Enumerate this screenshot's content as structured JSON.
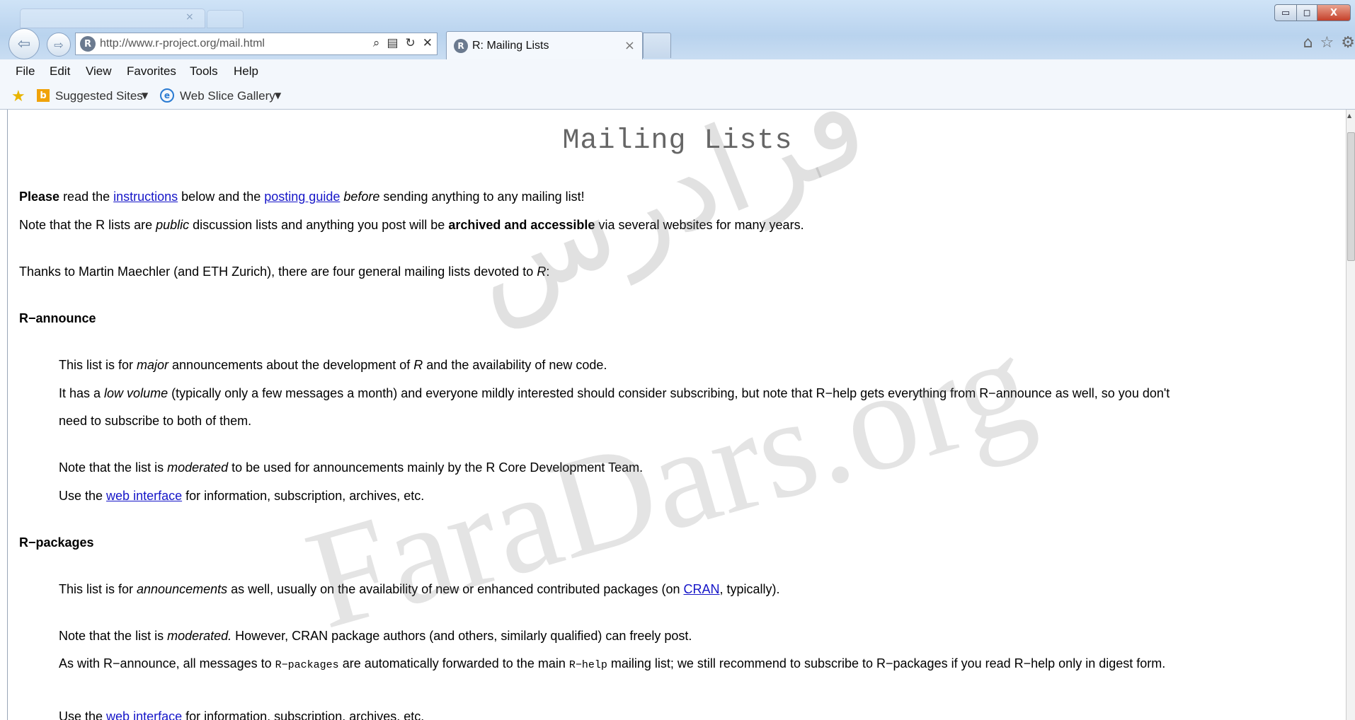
{
  "browser": {
    "address_url": "http://www.r-project.org/mail.html",
    "tab_title": "R: Mailing Lists",
    "tab_close": "×",
    "menu": [
      "File",
      "Edit",
      "View",
      "Favorites",
      "Tools",
      "Help"
    ],
    "favorites": {
      "suggested_sites": "Suggested Sites",
      "web_slice_gallery": "Web Slice Gallery"
    },
    "window_controls": {
      "minimize": "▭",
      "maximize": "◻",
      "close": "X"
    }
  },
  "page": {
    "title": "Mailing Lists",
    "intro1": {
      "bold": "Please",
      "t1": " read the ",
      "link_instructions": "instructions",
      "t2": " below and the ",
      "link_posting_guide": "posting guide",
      "t3": " ",
      "em_before": "before",
      "t4": " sending anything to any mailing list!"
    },
    "intro2": {
      "t1": "Note that the R lists are ",
      "em_public": "public",
      "t2": " discussion lists and anything you post will be ",
      "bold": "archived and accessible",
      "t3": " via several websites for many years."
    },
    "intro3": {
      "t1": "Thanks to Martin Maechler (and ETH Zurich), there are four general mailing lists devoted to ",
      "em_r": "R",
      "t2": ":"
    },
    "r_announce": {
      "heading": "R−announce",
      "p1": {
        "t1": "This list is for ",
        "em": "major",
        "t2": " announcements about the development of ",
        "em_r": "R",
        "t3": " and the availability of new code."
      },
      "p2": {
        "t1": "It has a ",
        "em": "low volume",
        "t2": " (typically only a few messages a month) and everyone mildly interested should consider subscribing, but note that R−help gets everything from R−announce as well, so you don't"
      },
      "p2b": "need to subscribe to both of them.",
      "p3": {
        "t1": "Note that the list is ",
        "em": "moderated",
        "t2": " to be used for announcements mainly by the R Core Development Team."
      },
      "p4": {
        "t1": "Use the ",
        "link": "web interface",
        "t2": " for information, subscription, archives, etc."
      }
    },
    "r_packages": {
      "heading": "R−packages",
      "p1": {
        "t1": "This list is for ",
        "em": "announcements",
        "t2": " as well, usually on the availability of new or enhanced contributed packages (on ",
        "link": "CRAN",
        "t3": ", typically)."
      },
      "p2": {
        "t1": "Note that the list is ",
        "em": "moderated.",
        "t2": " However, CRAN package authors (and others, similarly qualified) can freely post."
      },
      "p3": {
        "t1": "As with R−announce, all messages to ",
        "code1": "R−packages",
        "t2": " are automatically forwarded to the main ",
        "code2": "R−help",
        "t3": " mailing list; we still recommend to subscribe to R−packages if you read R−help only in digest form."
      },
      "p4": {
        "t1": "Use the ",
        "link": "web interface",
        "t2": " for information, subscription, archives, etc."
      }
    },
    "watermark": {
      "latin": "FaraDars.org",
      "persian": "فرادرس"
    }
  }
}
